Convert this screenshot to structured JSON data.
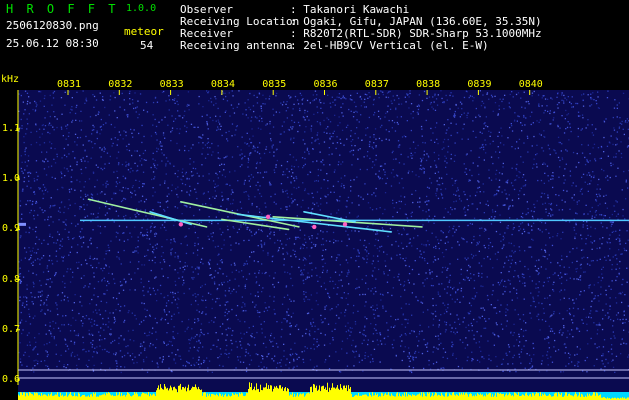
{
  "header": {
    "app_title": "H R O F F T",
    "app_version": "1.0.0",
    "filename": "2506120830.png",
    "datetime": "25.06.12 08:30",
    "meteor_label": "meteor",
    "meteor_count": "54"
  },
  "station_info": [
    {
      "label": "Observer",
      "value": ": Takanori Kawachi"
    },
    {
      "label": "Receiving Location",
      "value": ": Ogaki, Gifu, JAPAN (136.60E, 35.35N)"
    },
    {
      "label": "Receiver",
      "value": ": R820T2(RTL-SDR) SDR-Sharp 53.1000MHz"
    },
    {
      "label": "Receiving antenna",
      "value": ": 2el-HB9CV Vertical (el. E-W)"
    }
  ],
  "axes": {
    "y_unit": "kHz",
    "x_ticks": [
      "0831",
      "0832",
      "0833",
      "0834",
      "0835",
      "0836",
      "0837",
      "0838",
      "0839",
      "0840"
    ],
    "y_ticks": [
      "1.1",
      "1.0",
      "0.9",
      "0.8",
      "0.7",
      "0.6"
    ]
  },
  "colors": {
    "background": "#000000",
    "plot_bg": "#0a0a50",
    "noise": "#3040c0",
    "carrier": "#50c8ff",
    "text_green": "#00e000",
    "text_white": "#ffffff",
    "text_yellow": "#ffff00",
    "power_yellow": "#ffff00",
    "power_cyan": "#00d8ff"
  },
  "meteor_echoes": [
    {
      "start_min": 831.4,
      "end_min": 833.7,
      "f_start": 0.96,
      "f_end": 0.905
    },
    {
      "start_min": 832.6,
      "end_min": 833.4,
      "f_start": 0.935,
      "f_end": 0.91
    },
    {
      "start_min": 833.2,
      "end_min": 835.5,
      "f_start": 0.955,
      "f_end": 0.905
    },
    {
      "start_min": 834.3,
      "end_min": 837.3,
      "f_start": 0.93,
      "f_end": 0.895
    },
    {
      "start_min": 835.0,
      "end_min": 837.9,
      "f_start": 0.925,
      "f_end": 0.905
    },
    {
      "start_min": 835.6,
      "end_min": 836.6,
      "f_start": 0.935,
      "f_end": 0.915
    },
    {
      "start_min": 834.0,
      "end_min": 835.3,
      "f_start": 0.92,
      "f_end": 0.9
    }
  ],
  "carrier_freq_khz": 0.918
}
